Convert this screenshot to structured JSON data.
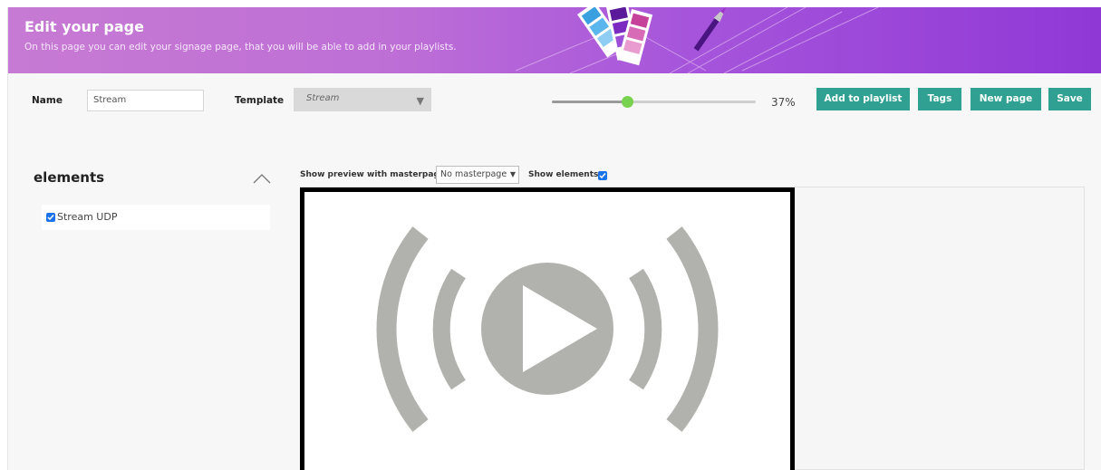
{
  "header": {
    "title": "Edit your page",
    "subtitle": "On this page you can edit your signage page, that you will be able to add in your playlists."
  },
  "form": {
    "name_label": "Name",
    "name_value": "Stream",
    "template_label": "Template",
    "template_value": "Stream"
  },
  "zoom": {
    "value": 37,
    "label": "37%"
  },
  "toolbar": {
    "add_to_playlist": "Add to playlist",
    "tags": "Tags",
    "new_page": "New page",
    "save": "Save"
  },
  "elements_panel": {
    "title": "elements",
    "items": [
      {
        "label": "Stream UDP",
        "checked": true
      }
    ]
  },
  "preview": {
    "masterpage_label": "Show preview with masterpage:",
    "masterpage_value": "No masterpage",
    "show_elements_label": "Show elements:",
    "show_elements_checked": true
  },
  "colors": {
    "accent_button": "#2fa091",
    "slider_thumb": "#79d24f",
    "banner_start": "#c77ad3",
    "banner_end": "#9038d6",
    "icon_gray": "#b1b1ad"
  },
  "icons": {
    "stream": "live-stream-icon",
    "collapse": "chevron-up-icon",
    "dropdown": "caret-down-icon"
  }
}
